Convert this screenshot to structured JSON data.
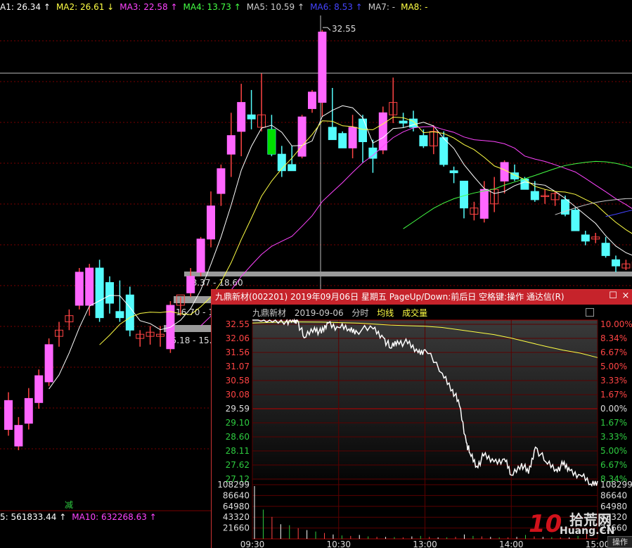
{
  "ma_legend": [
    {
      "label": "A1: 26.34",
      "arrow": "↑",
      "color": "#ffffff"
    },
    {
      "label": "MA2: 26.61",
      "arrow": "↓",
      "color": "#ffff44"
    },
    {
      "label": "MA3: 22.58",
      "arrow": "↑",
      "color": "#ff44ff"
    },
    {
      "label": "MA4: 13.73",
      "arrow": "↑",
      "color": "#44ff44"
    },
    {
      "label": "MA5: 10.59",
      "arrow": "↑",
      "color": "#cccccc"
    },
    {
      "label": "MA6: 8.53",
      "arrow": "↑",
      "color": "#4444ff"
    },
    {
      "label": "MA7: -",
      "arrow": "",
      "color": "#cccccc"
    },
    {
      "label": "MA8: -",
      "arrow": "",
      "color": "#ffff44"
    }
  ],
  "peak_label": "32.55",
  "price_zones": [
    "18.37 - 18.60",
    "16.70 - 1",
    "15.18 - 15.6"
  ],
  "volume_legend": [
    {
      "label": "5: 561833.44",
      "arrow": "↑",
      "color": "#ffffff"
    },
    {
      "label": "MA10: 632268.63",
      "arrow": "↑",
      "color": "#ff44ff"
    }
  ],
  "reduce_marker": "减",
  "popup": {
    "title": "九鼎新材(002201) 2019年09月06日 星期五 PageUp/Down:前后日 空格键:操作 通达信(R)",
    "restore_icon": "☐",
    "close_icon": "×",
    "stock_name": "九鼎新材",
    "date": "2019-09-06",
    "chart_kind": "分时",
    "avg_line_label": "均线",
    "volume_label": "成交量",
    "op_button": "操作"
  },
  "logo": {
    "num": "10",
    "cn": "拾荒网",
    "en": "Huang.CN"
  },
  "colors": {
    "up": "#ff4444",
    "down": "#54fcfc",
    "up_fill": "#ff66ff",
    "bg": "#000000",
    "grid": "#8b0000"
  },
  "chart_data": [
    {
      "type": "candlestick",
      "peak_value": 32.55,
      "candles": [
        {
          "o": 13.2,
          "h": 15.0,
          "l": 12.9,
          "c": 14.6
        },
        {
          "o": 12.4,
          "h": 13.8,
          "l": 12.2,
          "c": 13.4
        },
        {
          "o": 13.5,
          "h": 15.2,
          "l": 13.2,
          "c": 14.7
        },
        {
          "o": 14.5,
          "h": 16.1,
          "l": 14.2,
          "c": 15.8
        },
        {
          "o": 15.5,
          "h": 17.6,
          "l": 15.3,
          "c": 17.3
        },
        {
          "o": 17.7,
          "h": 18.4,
          "l": 17.2,
          "c": 18.0
        },
        {
          "o": 18.4,
          "h": 19.0,
          "l": 18.0,
          "c": 18.7
        },
        {
          "o": 19.2,
          "h": 21.0,
          "l": 19.0,
          "c": 20.8
        },
        {
          "o": 19.2,
          "h": 21.2,
          "l": 18.7,
          "c": 21.0
        },
        {
          "o": 21.0,
          "h": 21.4,
          "l": 18.4,
          "c": 18.6
        },
        {
          "o": 20.3,
          "h": 20.6,
          "l": 18.8,
          "c": 19.3
        },
        {
          "o": 18.9,
          "h": 20.4,
          "l": 18.4,
          "c": 18.6
        },
        {
          "o": 19.7,
          "h": 20.1,
          "l": 17.7,
          "c": 18.0
        },
        {
          "o": 17.6,
          "h": 18.0,
          "l": 17.2,
          "c": 17.8
        },
        {
          "o": 17.7,
          "h": 18.2,
          "l": 17.3,
          "c": 17.9
        },
        {
          "o": 17.7,
          "h": 18.2,
          "l": 17.2,
          "c": 17.8
        },
        {
          "o": 17.1,
          "h": 19.4,
          "l": 16.9,
          "c": 19.2
        },
        {
          "o": 19.2,
          "h": 19.6,
          "l": 18.7,
          "c": 19.7
        },
        {
          "o": 19.8,
          "h": 21.0,
          "l": 19.6,
          "c": 20.6
        },
        {
          "o": 20.8,
          "h": 22.5,
          "l": 20.6,
          "c": 22.4
        },
        {
          "o": 22.4,
          "h": 24.7,
          "l": 22.0,
          "c": 24.0
        },
        {
          "o": 24.6,
          "h": 26.0,
          "l": 24.0,
          "c": 25.8
        },
        {
          "o": 26.5,
          "h": 28.5,
          "l": 25.4,
          "c": 27.4
        },
        {
          "o": 27.6,
          "h": 29.9,
          "l": 26.4,
          "c": 29.0
        },
        {
          "o": 28.4,
          "h": 29.6,
          "l": 27.7,
          "c": 28.2
        },
        {
          "o": 27.8,
          "h": 30.4,
          "l": 27.6,
          "c": 28.4
        },
        {
          "o": 27.7,
          "h": 28.4,
          "l": 26.4,
          "c": 26.5
        },
        {
          "o": 26.5,
          "h": 26.9,
          "l": 25.4,
          "c": 25.7
        },
        {
          "o": 26.0,
          "h": 26.9,
          "l": 25.8,
          "c": 25.7
        },
        {
          "o": 26.4,
          "h": 28.4,
          "l": 26.3,
          "c": 28.3
        },
        {
          "o": 28.7,
          "h": 29.6,
          "l": 28.5,
          "c": 29.5
        },
        {
          "o": 29.0,
          "h": 32.5,
          "l": 28.3,
          "c": 32.4
        },
        {
          "o": 27.8,
          "h": 29.7,
          "l": 27.2,
          "c": 27.2
        },
        {
          "o": 27.5,
          "h": 27.6,
          "l": 26.9,
          "c": 26.8
        },
        {
          "o": 26.8,
          "h": 28.4,
          "l": 26.3,
          "c": 27.8
        },
        {
          "o": 28.2,
          "h": 28.4,
          "l": 26.1,
          "c": 27.1
        },
        {
          "o": 26.8,
          "h": 27.2,
          "l": 25.6,
          "c": 26.3
        },
        {
          "o": 26.7,
          "h": 28.8,
          "l": 26.5,
          "c": 28.5
        },
        {
          "o": 28.4,
          "h": 30.2,
          "l": 28.0,
          "c": 29.0
        },
        {
          "o": 28.1,
          "h": 28.5,
          "l": 27.8,
          "c": 28.0
        },
        {
          "o": 28.2,
          "h": 28.6,
          "l": 27.6,
          "c": 27.8
        },
        {
          "o": 27.4,
          "h": 27.7,
          "l": 26.8,
          "c": 26.9
        },
        {
          "o": 26.9,
          "h": 27.9,
          "l": 26.5,
          "c": 27.6
        },
        {
          "o": 27.3,
          "h": 27.6,
          "l": 25.9,
          "c": 26.0
        },
        {
          "o": 25.7,
          "h": 25.9,
          "l": 25.1,
          "c": 25.6
        },
        {
          "o": 25.2,
          "h": 25.2,
          "l": 23.4,
          "c": 23.9
        },
        {
          "o": 23.6,
          "h": 24.2,
          "l": 23.3,
          "c": 23.9
        },
        {
          "o": 23.4,
          "h": 25.2,
          "l": 23.2,
          "c": 24.8
        },
        {
          "o": 24.1,
          "h": 25.4,
          "l": 23.7,
          "c": 24.8
        },
        {
          "o": 25.2,
          "h": 26.2,
          "l": 24.6,
          "c": 26.1
        },
        {
          "o": 25.6,
          "h": 26.0,
          "l": 25.2,
          "c": 25.3
        },
        {
          "o": 25.3,
          "h": 25.4,
          "l": 24.9,
          "c": 24.8
        },
        {
          "o": 24.7,
          "h": 25.2,
          "l": 24.2,
          "c": 24.3
        },
        {
          "o": 24.5,
          "h": 24.8,
          "l": 24.1,
          "c": 24.5
        },
        {
          "o": 24.3,
          "h": 24.7,
          "l": 24.0,
          "c": 24.6
        },
        {
          "o": 24.3,
          "h": 24.5,
          "l": 23.5,
          "c": 23.6
        },
        {
          "o": 23.8,
          "h": 23.9,
          "l": 22.9,
          "c": 22.8
        },
        {
          "o": 22.6,
          "h": 22.8,
          "l": 22.1,
          "c": 22.3
        },
        {
          "o": 22.4,
          "h": 22.7,
          "l": 22.2,
          "c": 22.5
        },
        {
          "o": 22.2,
          "h": 22.5,
          "l": 21.5,
          "c": 21.6
        },
        {
          "o": 21.4,
          "h": 21.6,
          "l": 20.8,
          "c": 21.1
        },
        {
          "o": 21.0,
          "h": 21.4,
          "l": 20.9,
          "c": 21.2
        },
        {
          "o": 21.0,
          "h": 21.5,
          "l": 20.8,
          "c": 21.3
        },
        {
          "o": 21.0,
          "h": 21.2,
          "l": 20.6,
          "c": 20.8
        }
      ]
    },
    {
      "type": "line",
      "title": "九鼎新材(002201) 2019-09-06 分时",
      "prev_close": 29.59,
      "price_ticks": [
        "32.55",
        "32.06",
        "31.56",
        "31.07",
        "30.58",
        "30.08",
        "29.59",
        "29.10",
        "28.60",
        "28.11",
        "27.62",
        "27.12"
      ],
      "pct_ticks": [
        "10.00%",
        "8.34%",
        "6.67%",
        "5.00%",
        "3.33%",
        "1.67%",
        "0.00%",
        "1.67%",
        "3.33%",
        "5.00%",
        "6.67%",
        "8.34%"
      ],
      "volume_ticks": [
        "108299",
        "86640",
        "64980",
        "43320",
        "21660"
      ],
      "time_ticks": [
        "09:30",
        "10:30",
        "13:00",
        "14:00",
        "15:00"
      ],
      "series": [
        {
          "name": "均线",
          "x": [
            0,
            0.1,
            0.2,
            0.3,
            0.4,
            0.45,
            0.5,
            0.55,
            0.6,
            0.65,
            0.7,
            0.75,
            0.8,
            0.85,
            0.9,
            0.95,
            1.0
          ],
          "values": [
            32.45,
            32.49,
            32.48,
            32.45,
            32.38,
            32.36,
            32.34,
            32.3,
            32.22,
            32.14,
            32.06,
            31.94,
            31.8,
            31.66,
            31.53,
            31.43,
            31.28
          ]
        },
        {
          "name": "价格",
          "x": [
            0,
            0.05,
            0.1,
            0.12,
            0.13,
            0.15,
            0.18,
            0.2,
            0.22,
            0.25,
            0.28,
            0.3,
            0.35,
            0.38,
            0.4,
            0.42,
            0.45,
            0.48,
            0.5,
            0.55,
            0.58,
            0.6,
            0.62,
            0.63,
            0.65,
            0.67,
            0.7,
            0.73,
            0.75,
            0.78,
            0.8,
            0.82,
            0.85,
            0.88,
            0.9,
            0.92,
            0.95,
            0.98,
            1.0
          ],
          "values": [
            32.55,
            32.55,
            32.55,
            32.5,
            32.55,
            31.95,
            32.3,
            32.1,
            32.45,
            32.3,
            32.25,
            32.2,
            32.25,
            31.95,
            31.6,
            31.85,
            31.75,
            31.45,
            31.55,
            30.75,
            30.2,
            29.65,
            28.4,
            28.05,
            27.6,
            27.95,
            27.75,
            27.85,
            27.3,
            27.7,
            27.35,
            28.25,
            27.75,
            27.5,
            27.65,
            27.45,
            27.3,
            27.0,
            27.1
          ]
        }
      ],
      "volume": [
        108299,
        60000,
        45000,
        30000,
        28000,
        22000,
        18000,
        15000,
        12000,
        9000,
        7000,
        6000,
        8000,
        5000,
        4000,
        4000,
        3500,
        3000,
        5000,
        6000,
        4000,
        3000,
        3000,
        4000,
        9000,
        6000,
        5000,
        4000,
        3000,
        3000,
        4000,
        8000,
        5000,
        4000,
        3500,
        3000,
        3000,
        6000,
        12000
      ]
    }
  ]
}
